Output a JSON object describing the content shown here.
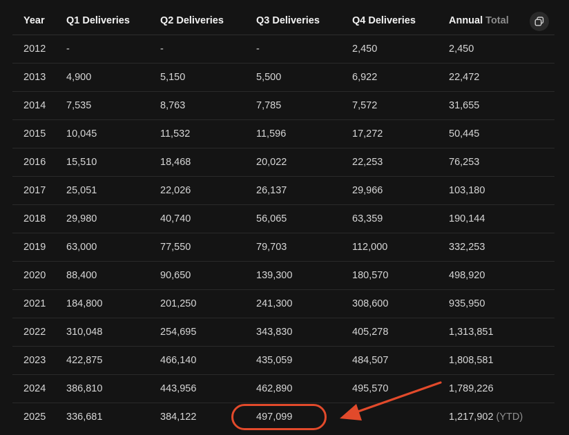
{
  "headers": {
    "year": "Year",
    "q1": "Q1 Deliveries",
    "q2": "Q2 Deliveries",
    "q3": "Q3 Deliveries",
    "q4": "Q4 Deliveries",
    "annual_a": "Annual",
    "annual_b": "Total"
  },
  "rows": [
    {
      "year": "2012",
      "q1": "-",
      "q2": "-",
      "q3": "-",
      "q4": "2,450",
      "total": "2,450"
    },
    {
      "year": "2013",
      "q1": "4,900",
      "q2": "5,150",
      "q3": "5,500",
      "q4": "6,922",
      "total": "22,472"
    },
    {
      "year": "2014",
      "q1": "7,535",
      "q2": "8,763",
      "q3": "7,785",
      "q4": "7,572",
      "total": "31,655"
    },
    {
      "year": "2015",
      "q1": "10,045",
      "q2": "11,532",
      "q3": "11,596",
      "q4": "17,272",
      "total": "50,445"
    },
    {
      "year": "2016",
      "q1": "15,510",
      "q2": "18,468",
      "q3": "20,022",
      "q4": "22,253",
      "total": "76,253"
    },
    {
      "year": "2017",
      "q1": "25,051",
      "q2": "22,026",
      "q3": "26,137",
      "q4": "29,966",
      "total": "103,180"
    },
    {
      "year": "2018",
      "q1": "29,980",
      "q2": "40,740",
      "q3": "56,065",
      "q4": "63,359",
      "total": "190,144"
    },
    {
      "year": "2019",
      "q1": "63,000",
      "q2": "77,550",
      "q3": "79,703",
      "q4": "112,000",
      "total": "332,253"
    },
    {
      "year": "2020",
      "q1": "88,400",
      "q2": "90,650",
      "q3": "139,300",
      "q4": "180,570",
      "total": "498,920"
    },
    {
      "year": "2021",
      "q1": "184,800",
      "q2": "201,250",
      "q3": "241,300",
      "q4": "308,600",
      "total": "935,950"
    },
    {
      "year": "2022",
      "q1": "310,048",
      "q2": "254,695",
      "q3": "343,830",
      "q4": "405,278",
      "total": "1,313,851"
    },
    {
      "year": "2023",
      "q1": "422,875",
      "q2": "466,140",
      "q3": "435,059",
      "q4": "484,507",
      "total": "1,808,581"
    },
    {
      "year": "2024",
      "q1": "386,810",
      "q2": "443,956",
      "q3": "462,890",
      "q4": "495,570",
      "total": "1,789,226"
    },
    {
      "year": "2025",
      "q1": "336,681",
      "q2": "384,122",
      "q3": "497,099",
      "q4": "",
      "total": "1,217,902",
      "total_suffix": "(YTD)"
    }
  ],
  "copy_button": {
    "icon": "copy-icon"
  },
  "annotation": {
    "color": "#e24a2b",
    "highlight": "2025 Q3 Deliveries"
  }
}
